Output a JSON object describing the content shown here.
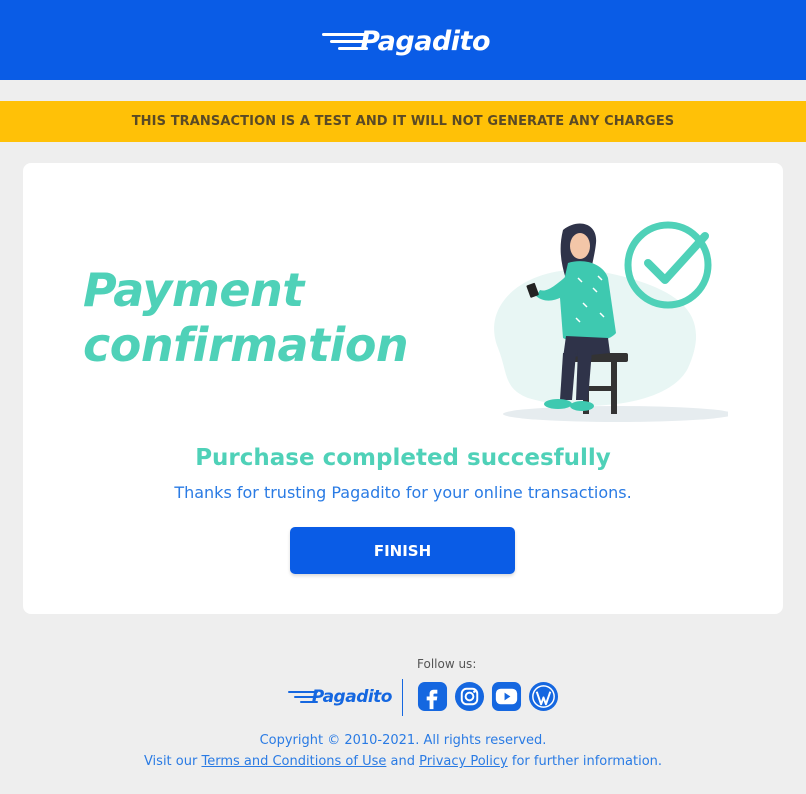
{
  "header": {
    "brand": "Pagadito"
  },
  "banner": {
    "text": "THIS TRANSACTION IS A TEST AND IT WILL NOT GENERATE ANY CHARGES"
  },
  "card": {
    "title": "Payment confirmation",
    "success": "Purchase completed succesfully",
    "thanks": "Thanks for trusting Pagadito for your online transactions.",
    "finish_label": "FINISH"
  },
  "footer": {
    "follow": "Follow us:",
    "brand": "Pagadito",
    "socials": [
      "facebook-icon",
      "instagram-icon",
      "youtube-icon",
      "wordpress-icon"
    ],
    "copyright": "Copyright © 2010-2021. All rights reserved.",
    "visit_prefix": "Visit our",
    "terms_link": "Terms and Conditions of Use",
    "and": "and",
    "privacy_link": "Privacy Policy",
    "suffix": "for further information."
  },
  "colors": {
    "primary": "#0a5ce6",
    "accent": "#4fd1b8",
    "warning": "#ffc107",
    "background": "#eeeeee"
  }
}
